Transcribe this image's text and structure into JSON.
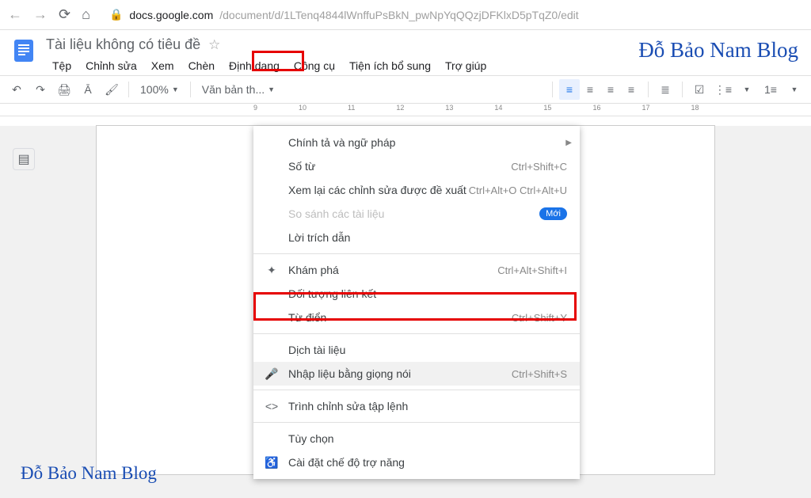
{
  "browser": {
    "url_host": "docs.google.com",
    "url_path": "/document/d/1LTenq4844lWnffuPsBkN_pwNpYqQQzjDFKlxD5pTqZ0/edit"
  },
  "header": {
    "title": "Tài liệu không có tiêu đề",
    "brand": "Đỗ Bảo Nam Blog"
  },
  "menubar": {
    "file": "Tệp",
    "edit": "Chỉnh sửa",
    "view": "Xem",
    "insert": "Chèn",
    "format": "Định dạng",
    "tools": "Công cụ",
    "addons": "Tiện ích bổ sung",
    "help": "Trợ giúp"
  },
  "toolbar": {
    "zoom": "100%",
    "style": "Văn bản th..."
  },
  "ruler": {
    "n9": "9",
    "n10": "10",
    "n11": "11",
    "n12": "12",
    "n13": "13",
    "n14": "14",
    "n15": "15",
    "n16": "16",
    "n17": "17",
    "n18": "18"
  },
  "menu": {
    "spelling": "Chính tả và ngữ pháp",
    "wordcount": "Số từ",
    "wordcount_sc": "Ctrl+Shift+C",
    "review": "Xem lại các chỉnh sửa được đề xuất",
    "review_sc": "Ctrl+Alt+O Ctrl+Alt+U",
    "compare": "So sánh các tài liệu",
    "compare_badge": "Mới",
    "citations": "Lời trích dẫn",
    "explore": "Khám phá",
    "explore_sc": "Ctrl+Alt+Shift+I",
    "linked": "Đối tượng liên kết",
    "dictionary": "Từ điển",
    "dictionary_sc": "Ctrl+Shift+Y",
    "translate": "Dịch tài liệu",
    "voice": "Nhập liệu bằng giọng nói",
    "voice_sc": "Ctrl+Shift+S",
    "script": "Trình chỉnh sửa tập lệnh",
    "prefs": "Tùy chọn",
    "a11y": "Cài đặt chế độ trợ năng"
  },
  "watermark": "Đỗ Bảo Nam Blog"
}
